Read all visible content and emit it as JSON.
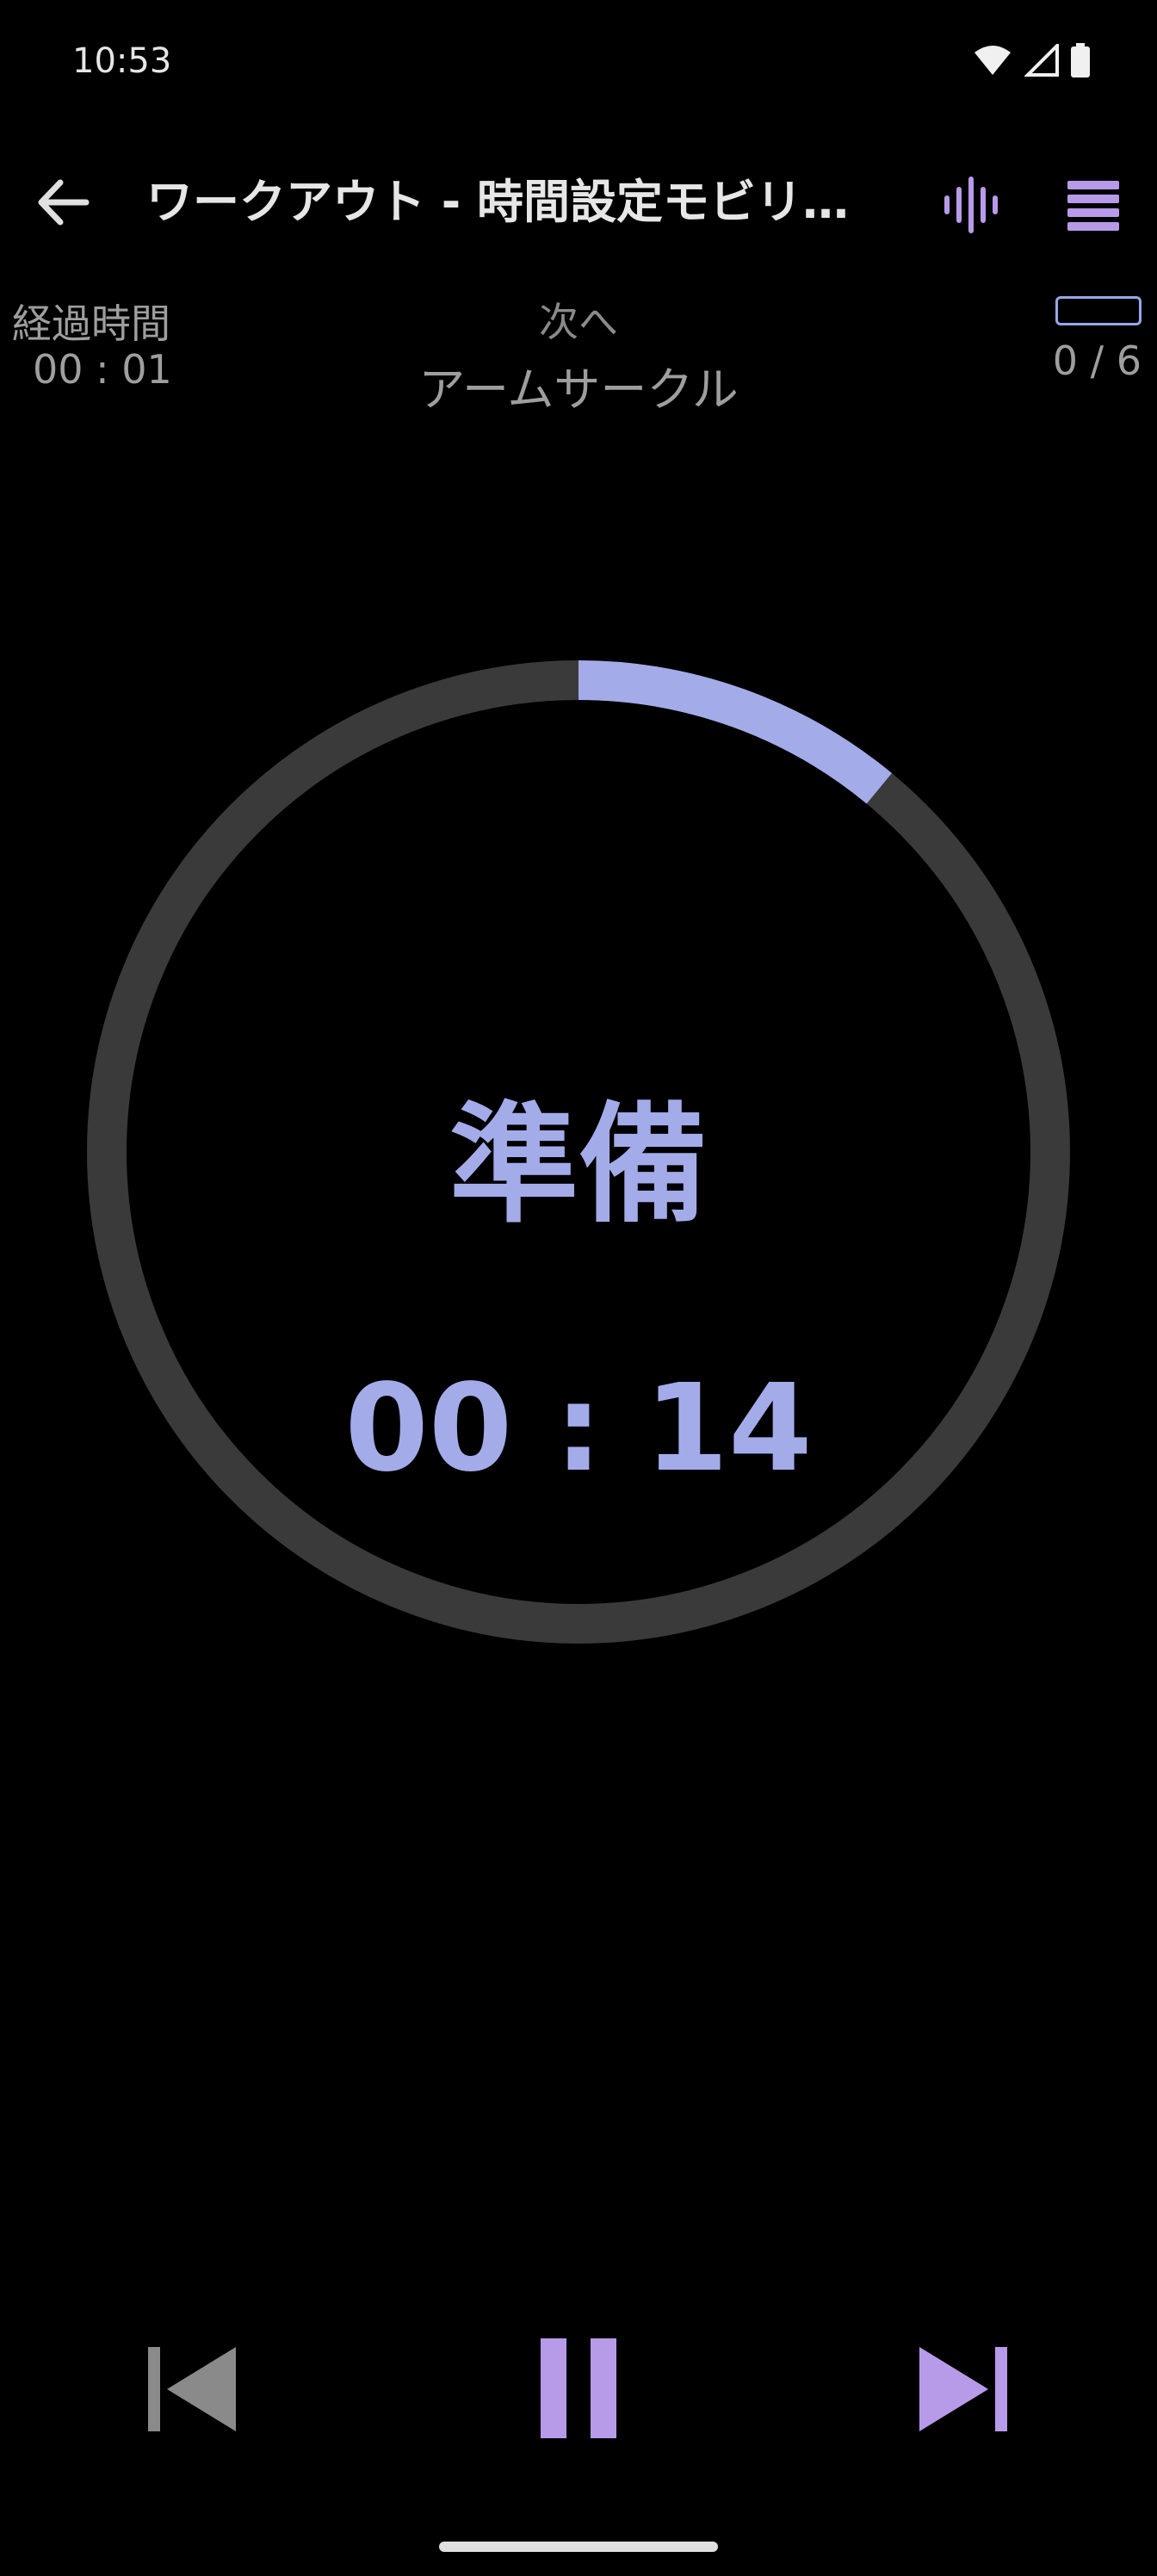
{
  "status": {
    "time": "10:53"
  },
  "toolbar": {
    "title": "ワークアウト - 時間設定モビリテ..."
  },
  "info": {
    "elapsed_label": "経過時間",
    "elapsed_value": "00 : 01",
    "next_label": "次へ",
    "next_value": "アームサークル",
    "progress_count": "0 / 6"
  },
  "timer": {
    "phase": "準備",
    "countdown": "00 : 14",
    "ring_progress": 0.11,
    "ring_color": "#a3ace9",
    "track_color": "#3a3a3a"
  },
  "colors": {
    "accent": "#b79be8",
    "icon_gray": "#8a8a8a"
  },
  "icons": [
    "back-arrow-icon",
    "sound-wave-icon",
    "menu-icon",
    "skip-previous-icon",
    "pause-icon",
    "skip-next-icon"
  ]
}
